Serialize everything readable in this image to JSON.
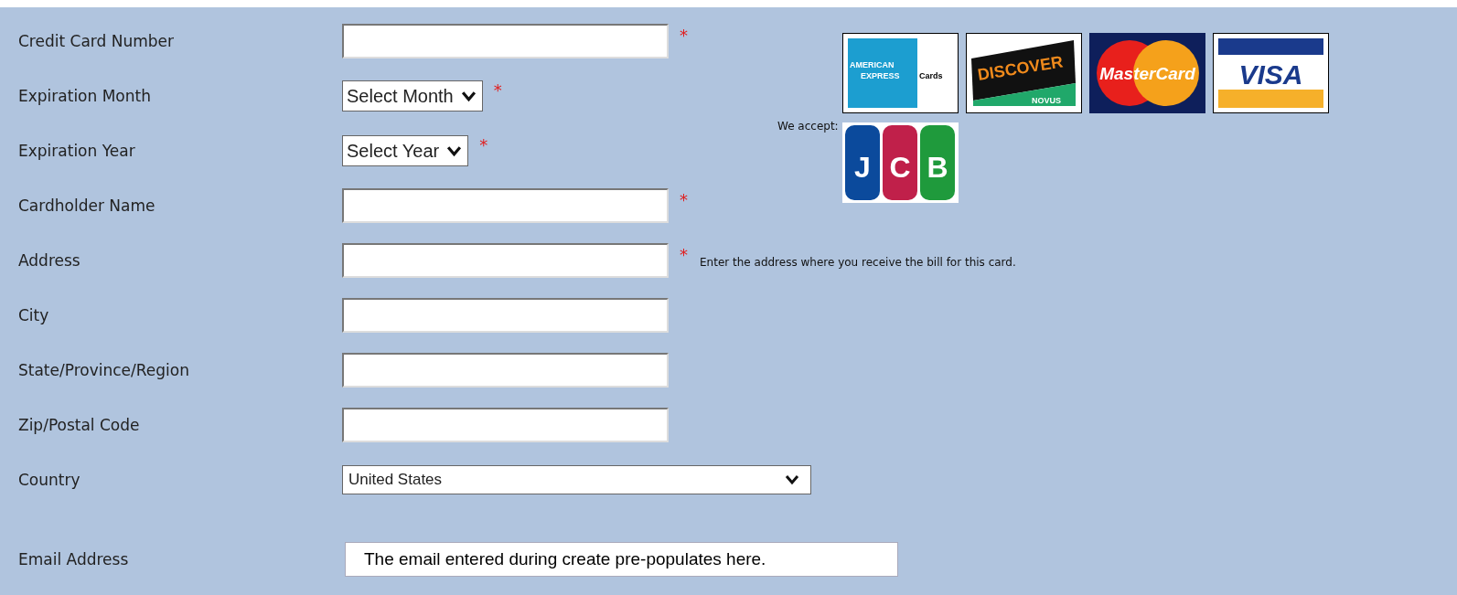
{
  "rows": [
    {
      "label": "Credit Card Number",
      "kind": "text",
      "mark": "*"
    },
    {
      "label": "Expiration Month",
      "kind": "select",
      "value": "Select Month",
      "mark": "*"
    },
    {
      "label": "Expiration Year",
      "kind": "select",
      "value": "Select Year",
      "mark": "*"
    },
    {
      "label": "Cardholder Name",
      "kind": "text",
      "mark": "*"
    },
    {
      "label": "Address",
      "kind": "text",
      "mark": "*",
      "hint": "Enter the address where you receive the bill for this card."
    },
    {
      "label": "City",
      "kind": "text"
    },
    {
      "label": "State/Province/Region",
      "kind": "text"
    },
    {
      "label": "Zip/Postal Code",
      "kind": "text"
    },
    {
      "label": "Country",
      "kind": "wide-select",
      "value": "United States"
    },
    {
      "label": "Email Address",
      "kind": "display",
      "value": "The email entered during create pre-populates here."
    }
  ],
  "cards": {
    "label": "We accept:",
    "logos": [
      {
        "kind": "amex",
        "texts": [
          "AMERICAN",
          "EXPRESS",
          "Cards"
        ]
      },
      {
        "kind": "discover",
        "texts": [
          "DISCOVER",
          "NOVUS"
        ]
      },
      {
        "kind": "mastercard",
        "texts": [
          "MasterCard"
        ]
      },
      {
        "kind": "visa",
        "texts": [
          "VISA"
        ]
      },
      {
        "kind": "jcb",
        "texts": [
          "J",
          "C",
          "B"
        ]
      }
    ]
  }
}
